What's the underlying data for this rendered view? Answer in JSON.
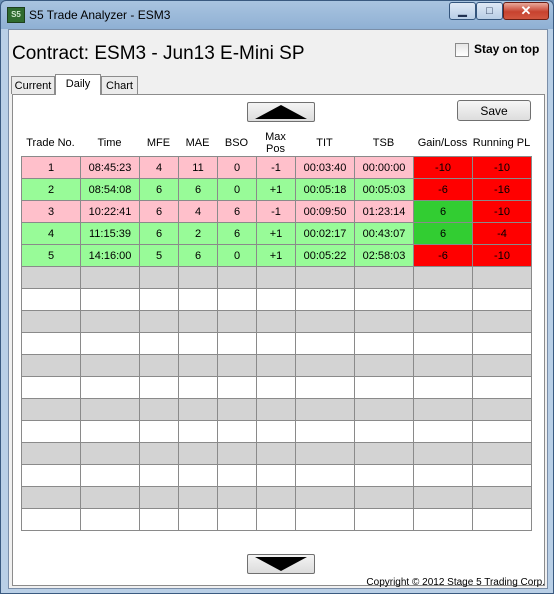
{
  "window": {
    "title": "S5 Trade Analyzer - ESM3",
    "app_icon": "S5"
  },
  "header": {
    "contract_label": "Contract:",
    "contract_value": "ESM3 - Jun13 E-Mini SP",
    "stay_on_top": "Stay on top",
    "stay_on_top_checked": false
  },
  "tabs": [
    {
      "label": "Current"
    },
    {
      "label": "Daily",
      "active": true
    },
    {
      "label": "Chart"
    }
  ],
  "toolbar": {
    "save_label": "Save"
  },
  "columns": [
    "Trade No.",
    "Time",
    "MFE",
    "MAE",
    "BSO",
    "Max Pos",
    "TIT",
    "TSB",
    "Gain/Loss",
    "Running PL"
  ],
  "rows": [
    {
      "trade": "1",
      "time": "08:45:23",
      "mfe": "4",
      "mae": "11",
      "bso": "0",
      "maxpos": "-1",
      "tit": "00:03:40",
      "tsb": "00:00:00",
      "gain": "-10",
      "running": "-10",
      "result": "loss",
      "running_status": "negative"
    },
    {
      "trade": "2",
      "time": "08:54:08",
      "mfe": "6",
      "mae": "6",
      "bso": "0",
      "maxpos": "+1",
      "tit": "00:05:18",
      "tsb": "00:05:03",
      "gain": "-6",
      "running": "-16",
      "result": "win",
      "running_status": "negative"
    },
    {
      "trade": "3",
      "time": "10:22:41",
      "mfe": "6",
      "mae": "4",
      "bso": "6",
      "maxpos": "-1",
      "tit": "00:09:50",
      "tsb": "01:23:14",
      "gain": "6",
      "running": "-10",
      "result": "loss",
      "running_status": "negative"
    },
    {
      "trade": "4",
      "time": "11:15:39",
      "mfe": "6",
      "mae": "2",
      "bso": "6",
      "maxpos": "+1",
      "tit": "00:02:17",
      "tsb": "00:43:07",
      "gain": "6",
      "running": "-4",
      "result": "win",
      "running_status": "negative"
    },
    {
      "trade": "5",
      "time": "14:16:00",
      "mfe": "5",
      "mae": "6",
      "bso": "0",
      "maxpos": "+1",
      "tit": "00:05:22",
      "tsb": "02:58:03",
      "gain": "-6",
      "running": "-10",
      "result": "win",
      "running_status": "negative"
    }
  ],
  "empty_rows": 12,
  "colors": {
    "loss_row": "#ffc0cb",
    "win_row": "#98fb98",
    "loss_cell": "#ff0000",
    "win_cell": "#32cd32",
    "empty_alt": "#d3d3d3",
    "empty": "#ffffff"
  },
  "footer": {
    "copyright": "Copyright © 2012 Stage 5 Trading Corp."
  }
}
